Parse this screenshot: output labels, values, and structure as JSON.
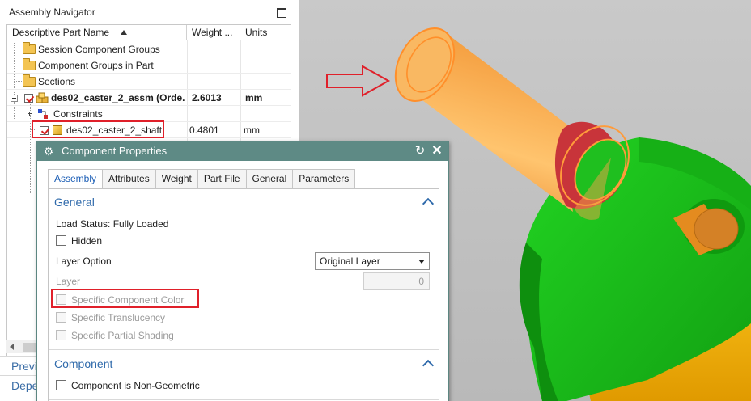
{
  "navigator": {
    "title": "Assembly Navigator",
    "columns": [
      "Descriptive Part Name",
      "Weight ...",
      "Units"
    ],
    "rows": [
      {
        "name": "Session Component Groups",
        "weight": "",
        "units": ""
      },
      {
        "name": "Component Groups in Part",
        "weight": "",
        "units": ""
      },
      {
        "name": "Sections",
        "weight": "",
        "units": ""
      },
      {
        "name": "des02_caster_2_assm (Orde...",
        "weight": "2.6013",
        "units": "mm"
      },
      {
        "name": "Constraints",
        "weight": "",
        "units": ""
      },
      {
        "name": "des02_caster_2_shaft",
        "weight": "0.4801",
        "units": "mm"
      }
    ],
    "bottom_tabs": [
      "Previ",
      "Depe"
    ]
  },
  "dialog": {
    "title": "Component Properties",
    "tabs": [
      "Assembly",
      "Attributes",
      "Weight",
      "Part File",
      "General",
      "Parameters"
    ],
    "active_tab": "Assembly",
    "general": {
      "section_title": "General",
      "load_status": "Load Status: Fully Loaded",
      "hidden_label": "Hidden",
      "layer_option_label": "Layer Option",
      "layer_option_value": "Original Layer",
      "layer_label": "Layer",
      "layer_value": "0",
      "specific_color_label": "Specific Component Color",
      "specific_translucency_label": "Specific Translucency",
      "specific_shading_label": "Specific Partial Shading"
    },
    "component": {
      "section_title": "Component",
      "non_geometric_label": "Component is Non-Geometric"
    }
  },
  "colors": {
    "dialog_titlebar": "#5e8a85",
    "section_blue": "#2f6aab",
    "highlight_red": "#e0202a",
    "shaft_orange": "#f7b35a",
    "bracket_green": "#1fc21f",
    "wheel_yellow": "#f2b600",
    "viewport_bg": "#c2c2c2"
  }
}
